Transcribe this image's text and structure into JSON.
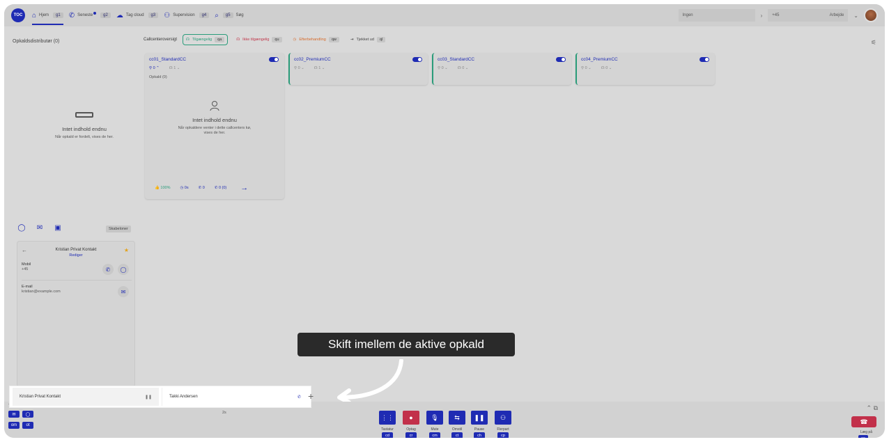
{
  "nav": {
    "logo": "TOC",
    "items": [
      {
        "label": "Hjem",
        "key": "g1"
      },
      {
        "label": "Seneste",
        "key": "g2"
      },
      {
        "label": "Tag cloud",
        "key": "g3"
      },
      {
        "label": "Supervision",
        "key": "g4"
      },
      {
        "label": "Søg",
        "key": "g5"
      }
    ],
    "status_select": "Ingen",
    "phone_prefix": "+45",
    "presence": "Arbejde"
  },
  "left": {
    "title": "Opkaldsdistributør (0)",
    "empty_title": "Intet indhold endnu",
    "empty_text": "Når opkald er fordelt, vises de her."
  },
  "callcenter": {
    "header": "Callcenteroversigt",
    "statuses": [
      {
        "label": "Tilgængelig",
        "key": "qa"
      },
      {
        "label": "Ikke tilgængelig",
        "key": "qu"
      },
      {
        "label": "Efterbehandling",
        "key": "qw"
      },
      {
        "label": "Tjekket ud",
        "key": "ql"
      }
    ],
    "cards": [
      {
        "name": "cc01_StandardCC",
        "agents": "0",
        "agents_online": "1",
        "calls": "Opkald (0)"
      },
      {
        "name": "cc02_PremiumCC",
        "agents": "0",
        "agents_online": "1"
      },
      {
        "name": "cc03_StandardCC",
        "agents": "0",
        "agents_online": "0"
      },
      {
        "name": "cc04_PremiumCC",
        "agents": "0",
        "agents_online": "0"
      }
    ],
    "card_empty_title": "Intet indhold endnu",
    "card_empty_text": "Når opkaldere venter i dette callcenters kø, vises de her.",
    "stats": [
      "100%",
      "0s",
      "0",
      "0 (0)"
    ]
  },
  "contact": {
    "templates_label": "Skabeloner",
    "name": "Kristian Privat Kontakt",
    "edit": "Rediger",
    "mobile_label": "Mobil",
    "mobile_value": "+45",
    "email_label": "E-mail",
    "email_value": "kristian@example.com"
  },
  "tooltip": "Skift imellem de aktive opkald",
  "call_tabs": [
    {
      "label": "Kristian Privat Kontakt",
      "status": "❚❚"
    },
    {
      "label": "Takki Andersen",
      "status": "✆"
    }
  ],
  "bottom": {
    "caller": "Takki Andersen",
    "count": "234",
    "duration": "2s",
    "keys_left": [
      "om",
      "ot"
    ],
    "controls": [
      {
        "label": "Tastatur",
        "key": "cd",
        "icon": "⋮⋮"
      },
      {
        "label": "Optag",
        "key": "cr",
        "icon": "●"
      },
      {
        "label": "Mute",
        "key": "cm",
        "icon": "🎙"
      },
      {
        "label": "Omstil",
        "key": "ct",
        "icon": "⇆"
      },
      {
        "label": "Pause",
        "key": "ch",
        "icon": "❚❚"
      },
      {
        "label": "Flerpart",
        "key": "cp",
        "icon": "⚇"
      }
    ],
    "hangup_label": "Læg på",
    "hangup_key": "ce"
  }
}
